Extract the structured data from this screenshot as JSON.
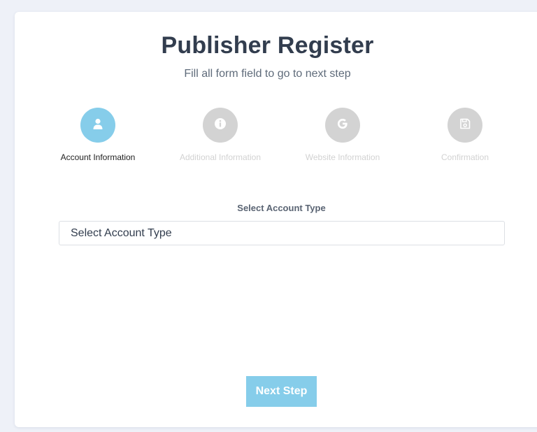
{
  "header": {
    "title": "Publisher Register",
    "subtitle": "Fill all form field to go to next step"
  },
  "steps": [
    {
      "label": "Account Information",
      "icon": "user-icon",
      "active": true
    },
    {
      "label": "Additional Information",
      "icon": "info-icon",
      "active": false
    },
    {
      "label": "Website Information",
      "icon": "google-icon",
      "active": false
    },
    {
      "label": "Confirmation",
      "icon": "save-icon",
      "active": false
    }
  ],
  "form": {
    "account_type_label": "Select Account Type",
    "account_type_value": "Select Account Type"
  },
  "actions": {
    "next_label": "Next Step"
  },
  "colors": {
    "accent": "#86cdea",
    "inactive": "#d3d3d3",
    "title": "#323d4e"
  }
}
